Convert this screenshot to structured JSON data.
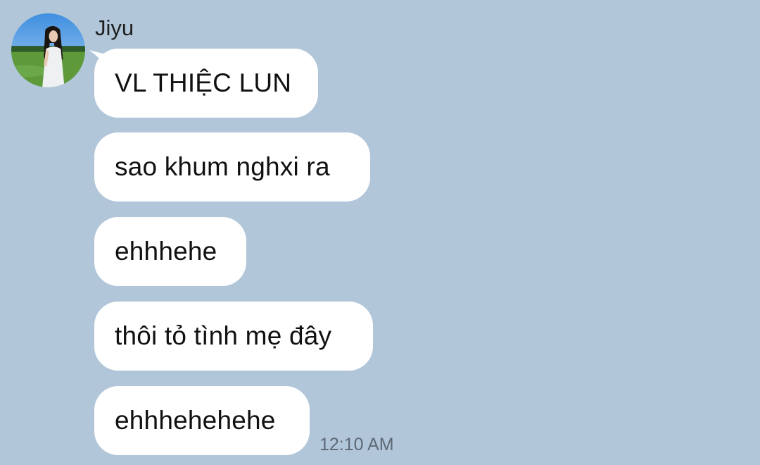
{
  "chat": {
    "sender": {
      "name": "Jiyu",
      "avatar": "user-avatar-photo"
    },
    "messages": [
      {
        "text": "VL THIỆC LUN"
      },
      {
        "text": "sao khum nghxi ra"
      },
      {
        "text": "ehhhehe"
      },
      {
        "text": "thôi tỏ tình mẹ đây"
      },
      {
        "text": "ehhhehehehe"
      }
    ],
    "last_timestamp": "12:10 AM"
  },
  "theme": {
    "background": "#b2c6da",
    "bubble": "#ffffff",
    "text": "#111111",
    "timestamp": "#5e6975"
  }
}
